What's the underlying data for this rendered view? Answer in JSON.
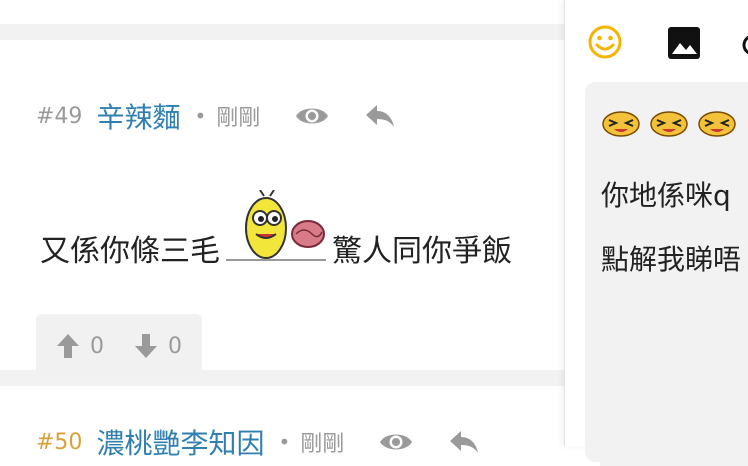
{
  "post49": {
    "number": "#49",
    "username": "辛辣麵",
    "separator": "•",
    "time": "剛剛",
    "text_before": "又係你條三毛",
    "text_after": "驚人同你爭飯",
    "upvotes": "0",
    "downvotes": "0"
  },
  "post50": {
    "number": "#50",
    "username": "濃桃艷李知因",
    "separator": "•",
    "time": "剛剛"
  },
  "reply_panel": {
    "line1": "你地係咪q",
    "line2": "點解我睇唔"
  },
  "icons": {
    "view": "eye-icon",
    "reply": "reply-icon",
    "upvote": "thumb-up-arrow-icon",
    "downvote": "thumb-down-arrow-icon",
    "emoji": "smiley-icon",
    "image": "image-icon"
  },
  "colors": {
    "username": "#2f7fb0",
    "emoji_accent": "#f5b400",
    "meta": "#9a9a9a"
  }
}
